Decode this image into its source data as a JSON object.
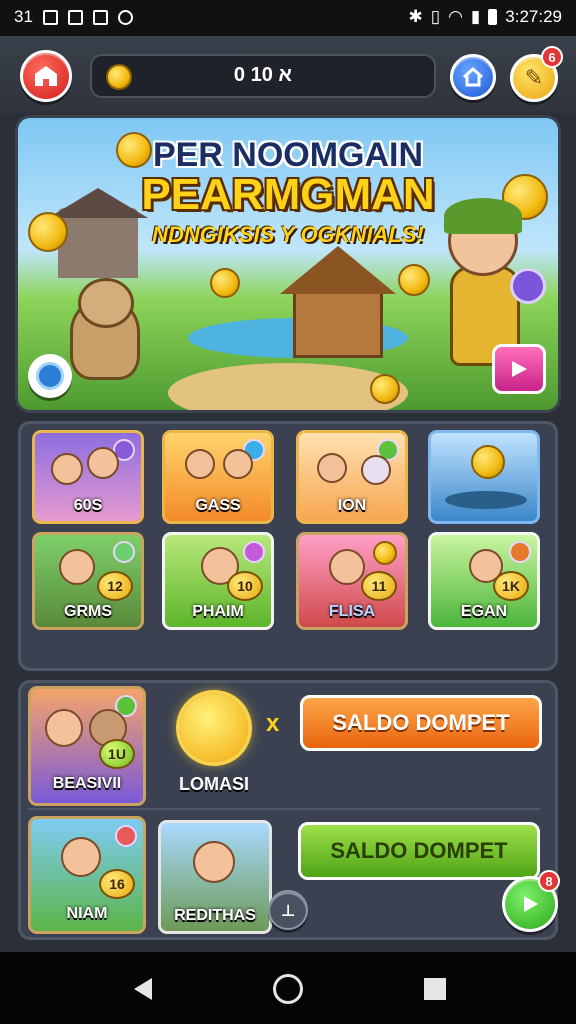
{
  "status_bar": {
    "left_text": "31",
    "time": "3:27:29"
  },
  "top_bar": {
    "coin_count": "0 א 10",
    "notification_count": "6"
  },
  "banner": {
    "title_line1": "PER NOOMGAIN",
    "title_line2": "PEARMGMAN",
    "subtitle": "NDNGIKSIS Y OGKNIALS!"
  },
  "games": [
    {
      "label": "60S",
      "theme": "purple"
    },
    {
      "label": "GASS",
      "theme": "orange"
    },
    {
      "label": "ION",
      "theme": "peach"
    },
    {
      "label": "",
      "theme": "blue"
    },
    {
      "label": "GRMS",
      "number": "12",
      "theme": "green"
    },
    {
      "label": "PHAIM",
      "number": "10",
      "theme": "lime"
    },
    {
      "label": "FLISA",
      "number": "11",
      "theme": "red"
    },
    {
      "label": "EGAN",
      "number": "1K",
      "theme": "green2"
    }
  ],
  "lower": {
    "card1_label": "BEASIVII",
    "card1_number": "1U",
    "sun_label": "LOMASI",
    "multiplier": "x",
    "button1_label": "SALDO DOMPET",
    "card2_label": "NIAM",
    "card2_number": "16",
    "card3_label": "REDITHAS",
    "button2_label": "SALDO DOMPET",
    "play_badge": "8"
  },
  "colors": {
    "orange_button": "#f6861a",
    "green_button": "#6cc21f",
    "gold": "#f2b90f"
  }
}
